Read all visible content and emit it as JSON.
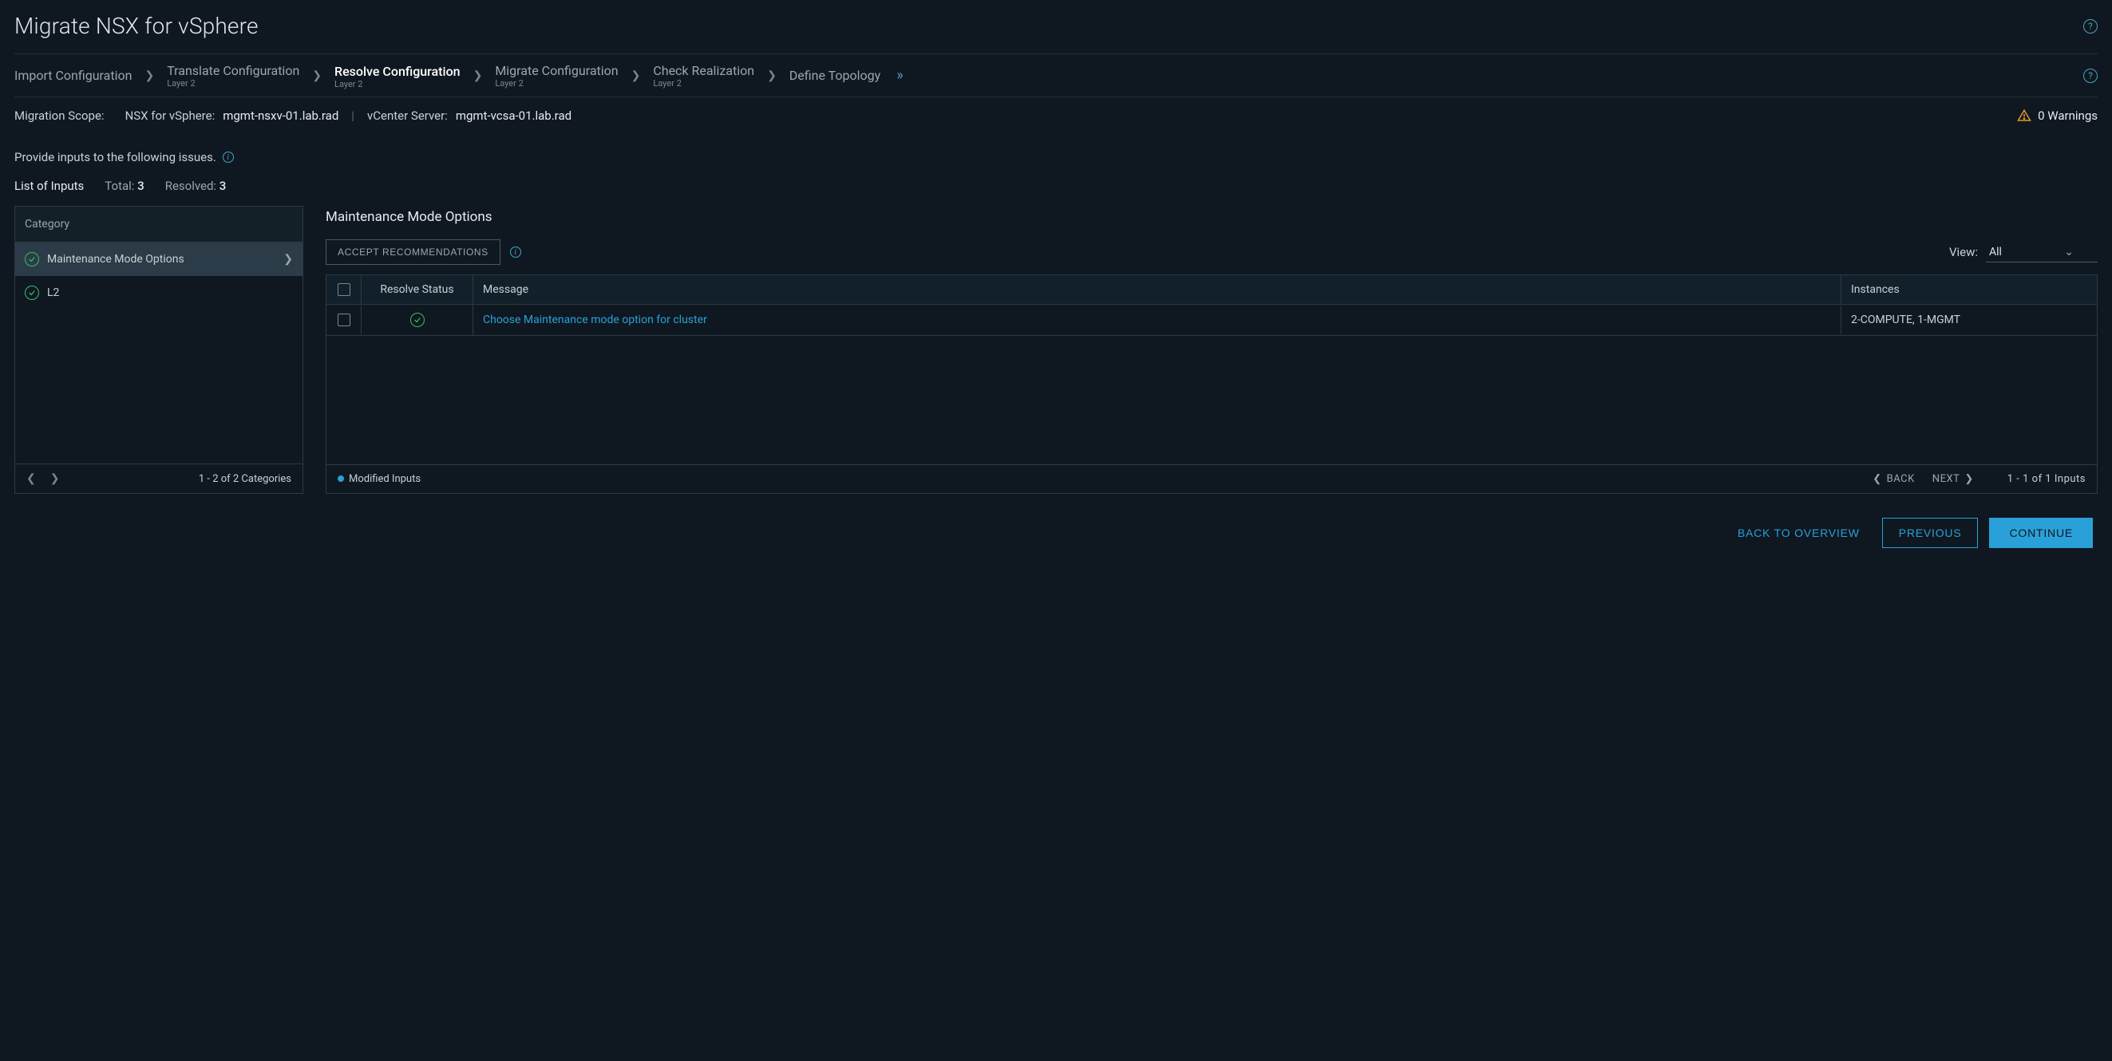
{
  "page_title": "Migrate NSX for vSphere",
  "steps": [
    {
      "label": "Import Configuration",
      "sub": ""
    },
    {
      "label": "Translate Configuration",
      "sub": "Layer 2"
    },
    {
      "label": "Resolve Configuration",
      "sub": "Layer 2"
    },
    {
      "label": "Migrate Configuration",
      "sub": "Layer 2"
    },
    {
      "label": "Check Realization",
      "sub": "Layer 2"
    },
    {
      "label": "Define Topology",
      "sub": ""
    }
  ],
  "scope": {
    "label": "Migration Scope:",
    "nsx_label": "NSX for vSphere:",
    "nsx_value": "mgmt-nsxv-01.lab.rad",
    "vc_label": "vCenter Server:",
    "vc_value": "mgmt-vcsa-01.lab.rad"
  },
  "warnings": {
    "text": "0 Warnings"
  },
  "instruction": "Provide inputs to the following issues.",
  "summary": {
    "title": "List of Inputs",
    "total_label": "Total:",
    "total_value": "3",
    "resolved_label": "Resolved:",
    "resolved_value": "3"
  },
  "categories": {
    "header": "Category",
    "items": [
      {
        "label": "Maintenance Mode Options",
        "selected": true
      },
      {
        "label": "L2",
        "selected": false
      }
    ],
    "footer": "1 - 2 of 2 Categories"
  },
  "detail": {
    "title": "Maintenance Mode Options",
    "accept_btn": "ACCEPT RECOMMENDATIONS",
    "view_label": "View:",
    "view_value": "All",
    "columns": {
      "status": "Resolve Status",
      "message": "Message",
      "instances": "Instances"
    },
    "rows": [
      {
        "message": "Choose Maintenance mode option for cluster",
        "instances": "2-COMPUTE, 1-MGMT"
      }
    ],
    "legend": "Modified Inputs",
    "pager": {
      "back": "BACK",
      "next": "NEXT",
      "range": "1 - 1 of 1 Inputs"
    }
  },
  "actions": {
    "overview": "BACK TO OVERVIEW",
    "previous": "PREVIOUS",
    "continue": "CONTINUE"
  }
}
